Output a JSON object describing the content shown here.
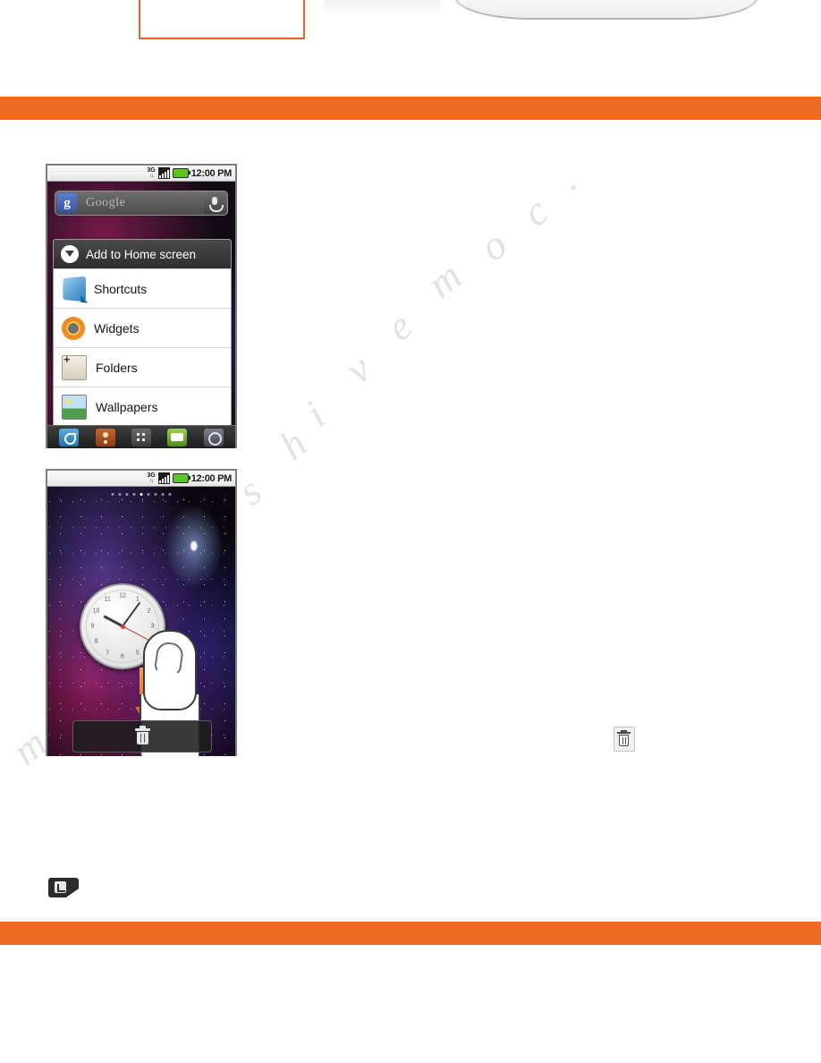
{
  "page": {
    "background_color": "#ffffff",
    "accent_color": "#ee6a20",
    "watermark_text": "manualshive.com"
  },
  "bars": {
    "top_bar_color": "#ee6a20",
    "bottom_bar_color": "#ee6a20"
  },
  "phone_1": {
    "status_bar": {
      "network_label": "3G",
      "time": "12:00 PM",
      "signal_icon": "signal-bars-icon",
      "battery_icon": "battery-icon"
    },
    "search_widget": {
      "logo_letter": "g",
      "placeholder": "Google",
      "mic_icon": "microphone-icon"
    },
    "context_menu": {
      "title": "Add to Home screen",
      "title_icon": "add-to-home-icon",
      "items": [
        {
          "label": "Shortcuts",
          "icon": "shortcuts-icon"
        },
        {
          "label": "Widgets",
          "icon": "widgets-icon"
        },
        {
          "label": "Folders",
          "icon": "folders-icon"
        },
        {
          "label": "Wallpapers",
          "icon": "wallpapers-icon"
        }
      ]
    },
    "dock": {
      "items": [
        {
          "icon": "phone-icon"
        },
        {
          "icon": "contacts-icon"
        },
        {
          "icon": "app-launcher-icon"
        },
        {
          "icon": "messaging-icon"
        },
        {
          "icon": "browser-icon"
        }
      ]
    }
  },
  "phone_2": {
    "status_bar": {
      "network_label": "3G",
      "time": "12:00 PM",
      "signal_icon": "signal-bars-icon",
      "battery_icon": "battery-icon"
    },
    "home_screen": {
      "page_dots_total": 9,
      "page_dots_active_index": 4,
      "clock_widget": {
        "numerals": [
          "12",
          "1",
          "2",
          "3",
          "4",
          "5",
          "6",
          "7",
          "8",
          "9",
          "10",
          "11"
        ],
        "hour_hand_angle_deg": -62,
        "minute_hand_angle_deg": 36,
        "second_hand_angle_deg": 118,
        "second_hand_color": "#d63b2a"
      },
      "drag_arrow": {
        "direction": "down",
        "color": "#e86a1e"
      },
      "finger_gesture": "drag-and-drop",
      "trash_dock": {
        "icon": "trash-icon",
        "background": "rgba(30,30,30,0.88)"
      }
    }
  },
  "inline_graphics": {
    "trash_icon_label": "trash-icon",
    "note_icon_label": "note-flag-icon"
  }
}
